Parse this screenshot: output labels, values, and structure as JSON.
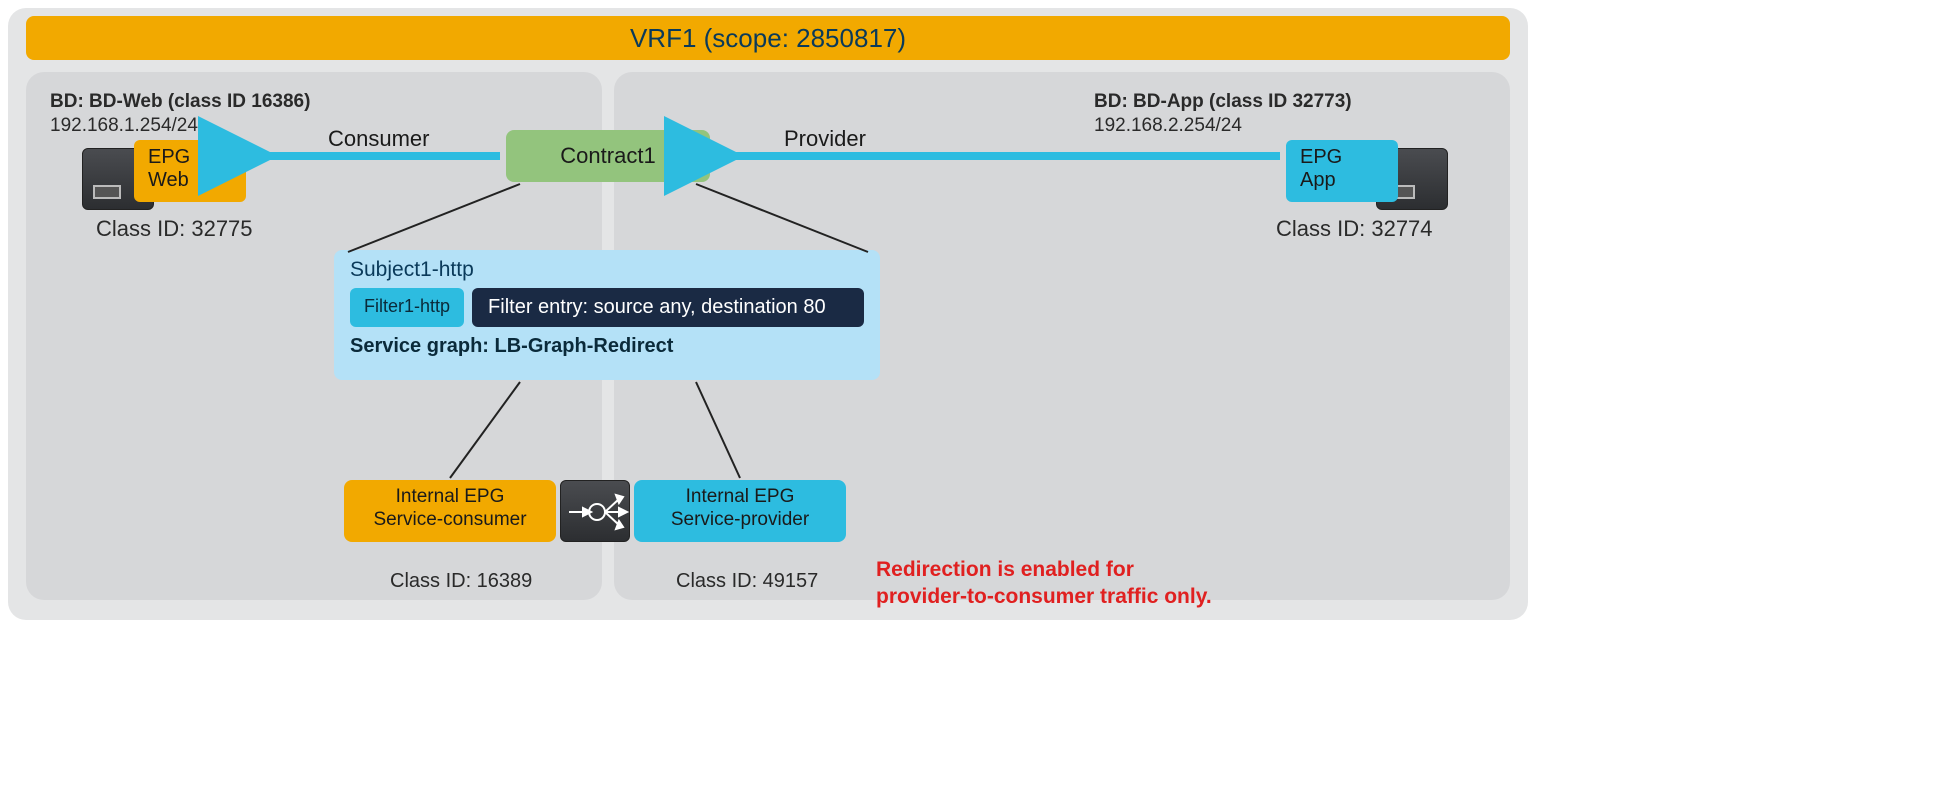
{
  "vrf": {
    "title": "VRF1 (scope: 2850817)"
  },
  "bd_web": {
    "line1": "BD: BD-Web (class ID 16386)",
    "line2": "192.168.1.254/24"
  },
  "bd_app": {
    "line1": "BD: BD-App (class ID 32773)",
    "line2": "192.168.2.254/24"
  },
  "epg_web": {
    "l1": "EPG",
    "l2": "Web",
    "class_id": "Class ID: 32775"
  },
  "epg_app": {
    "l1": "EPG",
    "l2": "App",
    "class_id": "Class ID: 32774"
  },
  "contract": {
    "name": "Contract1"
  },
  "labels": {
    "consumer": "Consumer",
    "provider": "Provider"
  },
  "subject": {
    "title": "Subject1-http",
    "filter_name": "Filter1-http",
    "filter_entry": "Filter entry: source any, destination 80",
    "service_graph": "Service graph: LB-Graph-Redirect"
  },
  "svc_consumer": {
    "l1": "Internal EPG",
    "l2": "Service-consumer",
    "class_id": "Class ID: 16389"
  },
  "svc_provider": {
    "l1": "Internal EPG",
    "l2": "Service-provider",
    "class_id": "Class ID: 49157"
  },
  "note": {
    "l1": "Redirection is enabled for",
    "l2": "provider-to-consumer traffic only."
  }
}
